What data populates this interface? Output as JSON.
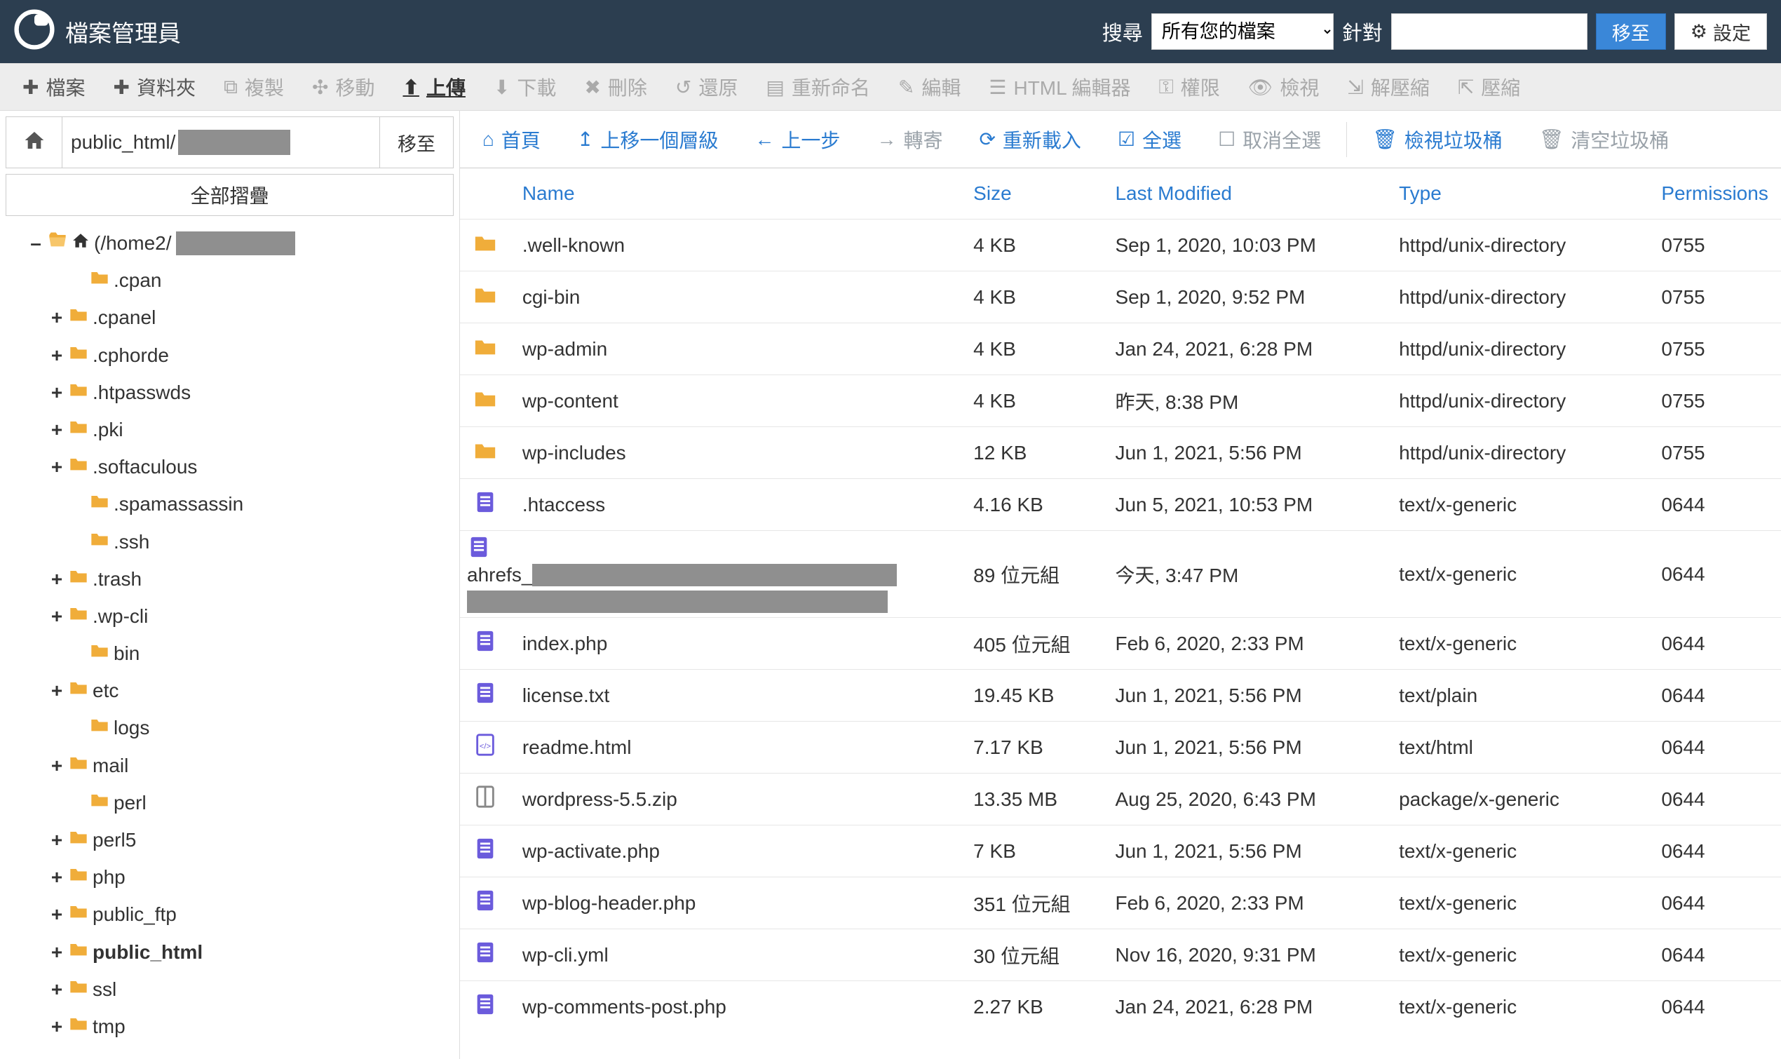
{
  "header": {
    "title": "檔案管理員",
    "search_label": "搜尋",
    "search_scope_selected": "所有您的檔案",
    "target_label": "針對",
    "go_button": "移至",
    "settings_button": "設定"
  },
  "main_toolbar": [
    {
      "id": "file",
      "label": "檔案",
      "icon": "plus-icon",
      "disabled": false
    },
    {
      "id": "folder",
      "label": "資料夾",
      "icon": "plus-icon",
      "disabled": false
    },
    {
      "id": "copy",
      "label": "複製",
      "icon": "copy-icon",
      "disabled": true
    },
    {
      "id": "move",
      "label": "移動",
      "icon": "move-icon",
      "disabled": true
    },
    {
      "id": "upload",
      "label": "上傳",
      "icon": "upload-icon",
      "disabled": false,
      "bold": true
    },
    {
      "id": "download",
      "label": "下載",
      "icon": "download-icon",
      "disabled": true
    },
    {
      "id": "delete",
      "label": "刪除",
      "icon": "delete-icon",
      "disabled": true
    },
    {
      "id": "restore",
      "label": "還原",
      "icon": "restore-icon",
      "disabled": true
    },
    {
      "id": "rename",
      "label": "重新命名",
      "icon": "rename-icon",
      "disabled": true
    },
    {
      "id": "edit",
      "label": "編輯",
      "icon": "edit-icon",
      "disabled": true
    },
    {
      "id": "htmleditor",
      "label": "HTML 編輯器",
      "icon": "html-editor-icon",
      "disabled": true
    },
    {
      "id": "permissions",
      "label": "權限",
      "icon": "key-icon",
      "disabled": true
    },
    {
      "id": "view",
      "label": "檢視",
      "icon": "eye-icon",
      "disabled": true
    },
    {
      "id": "extract",
      "label": "解壓縮",
      "icon": "extract-icon",
      "disabled": true
    },
    {
      "id": "compress",
      "label": "壓縮",
      "icon": "compress-icon",
      "disabled": true
    }
  ],
  "path_bar": {
    "path_value": "public_html/",
    "go_label": "移至"
  },
  "collapse_label": "全部摺疊",
  "tree": {
    "root_label": "(/home2/",
    "items": [
      {
        "toggle": "",
        "depth": 2,
        "label": ".cpan"
      },
      {
        "toggle": "+",
        "depth": 1,
        "label": ".cpanel"
      },
      {
        "toggle": "+",
        "depth": 1,
        "label": ".cphorde"
      },
      {
        "toggle": "+",
        "depth": 1,
        "label": ".htpasswds"
      },
      {
        "toggle": "+",
        "depth": 1,
        "label": ".pki"
      },
      {
        "toggle": "+",
        "depth": 1,
        "label": ".softaculous"
      },
      {
        "toggle": "",
        "depth": 2,
        "label": ".spamassassin"
      },
      {
        "toggle": "",
        "depth": 2,
        "label": ".ssh"
      },
      {
        "toggle": "+",
        "depth": 1,
        "label": ".trash"
      },
      {
        "toggle": "+",
        "depth": 1,
        "label": ".wp-cli"
      },
      {
        "toggle": "",
        "depth": 2,
        "label": "bin"
      },
      {
        "toggle": "+",
        "depth": 1,
        "label": "etc"
      },
      {
        "toggle": "",
        "depth": 2,
        "label": "logs"
      },
      {
        "toggle": "+",
        "depth": 1,
        "label": "mail"
      },
      {
        "toggle": "",
        "depth": 2,
        "label": "perl"
      },
      {
        "toggle": "+",
        "depth": 1,
        "label": "perl5"
      },
      {
        "toggle": "+",
        "depth": 1,
        "label": "php"
      },
      {
        "toggle": "+",
        "depth": 1,
        "label": "public_ftp"
      },
      {
        "toggle": "+",
        "depth": 1,
        "label": "public_html",
        "bold": true
      },
      {
        "toggle": "+",
        "depth": 1,
        "label": "ssl"
      },
      {
        "toggle": "+",
        "depth": 1,
        "label": "tmp"
      }
    ]
  },
  "action_bar": [
    {
      "id": "home",
      "label": "首頁",
      "icon": "home-icon",
      "style": "blue"
    },
    {
      "id": "up",
      "label": "上移一個層級",
      "icon": "up-level-icon",
      "style": "blue"
    },
    {
      "id": "back",
      "label": "上一步",
      "icon": "back-icon",
      "style": "blue"
    },
    {
      "id": "forward",
      "label": "轉寄",
      "icon": "forward-icon",
      "style": "gray"
    },
    {
      "id": "reload",
      "label": "重新載入",
      "icon": "reload-icon",
      "style": "blue"
    },
    {
      "id": "selectall",
      "label": "全選",
      "icon": "select-all-icon",
      "style": "blue"
    },
    {
      "id": "unselectall",
      "label": "取消全選",
      "icon": "unselect-all-icon",
      "style": "gray"
    },
    {
      "sep": true
    },
    {
      "id": "viewtrash",
      "label": "檢視垃圾桶",
      "icon": "trash-icon",
      "style": "blue"
    },
    {
      "id": "emptytrash",
      "label": "清空垃圾桶",
      "icon": "trash-icon",
      "style": "gray"
    }
  ],
  "table": {
    "headers": {
      "name": "Name",
      "size": "Size",
      "modified": "Last Modified",
      "type": "Type",
      "permissions": "Permissions"
    },
    "rows": [
      {
        "icon": "folder",
        "name": ".well-known",
        "size": "4 KB",
        "modified": "Sep 1, 2020, 10:03 PM",
        "type": "httpd/unix-directory",
        "perm": "0755"
      },
      {
        "icon": "folder",
        "name": "cgi-bin",
        "size": "4 KB",
        "modified": "Sep 1, 2020, 9:52 PM",
        "type": "httpd/unix-directory",
        "perm": "0755"
      },
      {
        "icon": "folder",
        "name": "wp-admin",
        "size": "4 KB",
        "modified": "Jan 24, 2021, 6:28 PM",
        "type": "httpd/unix-directory",
        "perm": "0755"
      },
      {
        "icon": "folder",
        "name": "wp-content",
        "size": "4 KB",
        "modified": "昨天, 8:38 PM",
        "type": "httpd/unix-directory",
        "perm": "0755"
      },
      {
        "icon": "folder",
        "name": "wp-includes",
        "size": "12 KB",
        "modified": "Jun 1, 2021, 5:56 PM",
        "type": "httpd/unix-directory",
        "perm": "0755"
      },
      {
        "icon": "doc",
        "name": ".htaccess",
        "size": "4.16 KB",
        "modified": "Jun 5, 2021, 10:53 PM",
        "type": "text/x-generic",
        "perm": "0644"
      },
      {
        "icon": "doc",
        "name": "ahrefs_",
        "size": "89 位元組",
        "modified": "今天, 3:47 PM",
        "type": "text/x-generic",
        "perm": "0644",
        "highlight": true,
        "redacted": true
      },
      {
        "icon": "doc",
        "name": "index.php",
        "size": "405 位元組",
        "modified": "Feb 6, 2020, 2:33 PM",
        "type": "text/x-generic",
        "perm": "0644"
      },
      {
        "icon": "doc",
        "name": "license.txt",
        "size": "19.45 KB",
        "modified": "Jun 1, 2021, 5:56 PM",
        "type": "text/plain",
        "perm": "0644"
      },
      {
        "icon": "html",
        "name": "readme.html",
        "size": "7.17 KB",
        "modified": "Jun 1, 2021, 5:56 PM",
        "type": "text/html",
        "perm": "0644"
      },
      {
        "icon": "zip",
        "name": "wordpress-5.5.zip",
        "size": "13.35 MB",
        "modified": "Aug 25, 2020, 6:43 PM",
        "type": "package/x-generic",
        "perm": "0644"
      },
      {
        "icon": "doc",
        "name": "wp-activate.php",
        "size": "7 KB",
        "modified": "Jun 1, 2021, 5:56 PM",
        "type": "text/x-generic",
        "perm": "0644"
      },
      {
        "icon": "doc",
        "name": "wp-blog-header.php",
        "size": "351 位元組",
        "modified": "Feb 6, 2020, 2:33 PM",
        "type": "text/x-generic",
        "perm": "0644"
      },
      {
        "icon": "doc",
        "name": "wp-cli.yml",
        "size": "30 位元組",
        "modified": "Nov 16, 2020, 9:31 PM",
        "type": "text/x-generic",
        "perm": "0644"
      },
      {
        "icon": "doc",
        "name": "wp-comments-post.php",
        "size": "2.27 KB",
        "modified": "Jan 24, 2021, 6:28 PM",
        "type": "text/x-generic",
        "perm": "0644"
      }
    ]
  },
  "icons": {
    "plus-icon": "✚",
    "copy-icon": "⧉",
    "move-icon": "✣",
    "upload-icon": "⬆",
    "download-icon": "⬇",
    "delete-icon": "✖",
    "restore-icon": "↺",
    "rename-icon": "▤",
    "edit-icon": "✎",
    "html-editor-icon": "☰",
    "key-icon": "⚿",
    "eye-icon": "👁",
    "extract-icon": "⇲",
    "compress-icon": "⇱",
    "home-icon": "⌂",
    "up-level-icon": "↥",
    "back-icon": "←",
    "forward-icon": "→",
    "reload-icon": "⟳",
    "select-all-icon": "☑",
    "unselect-all-icon": "☐",
    "trash-icon": "🗑",
    "gear-icon": "⚙"
  }
}
